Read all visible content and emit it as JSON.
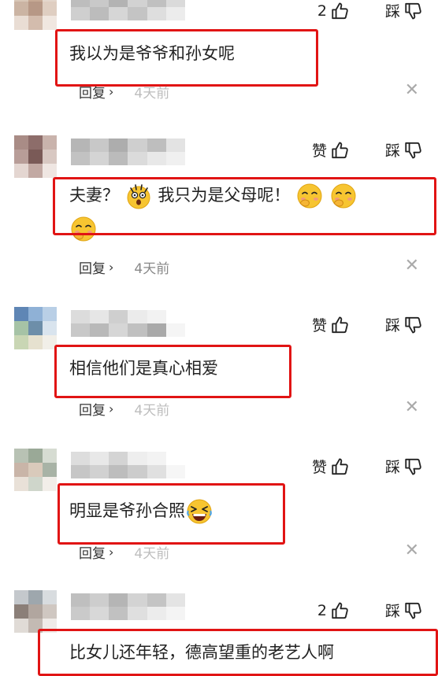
{
  "comments": [
    {
      "like_label": "2",
      "dislike_label": "踩",
      "text": "我以为是爷爷和孙女呢",
      "reply_label": "回复",
      "time": "4天前"
    },
    {
      "like_label": "赞",
      "dislike_label": "踩",
      "text_a": "夫妻？",
      "text_b": "我只为是父母呢！",
      "reply_label": "回复",
      "time": "4天前"
    },
    {
      "like_label": "赞",
      "dislike_label": "踩",
      "text": "相信他们是真心相爱",
      "reply_label": "回复",
      "time": "4天前"
    },
    {
      "like_label": "赞",
      "dislike_label": "踩",
      "text": "明显是爷孙合照",
      "reply_label": "回复",
      "time": "4天前"
    },
    {
      "like_label": "2",
      "dislike_label": "踩",
      "text": "比女儿还年轻，德高望重的老艺人啊"
    }
  ],
  "colors": {
    "highlight_box": "#e11414",
    "meta_text": "#888888"
  },
  "icons": [
    "thumb-up-icon",
    "thumb-down-icon",
    "close-icon",
    "chevron-right-icon",
    "shocked-emoji-icon",
    "shy-emoji-icon",
    "laughing-emoji-icon"
  ]
}
